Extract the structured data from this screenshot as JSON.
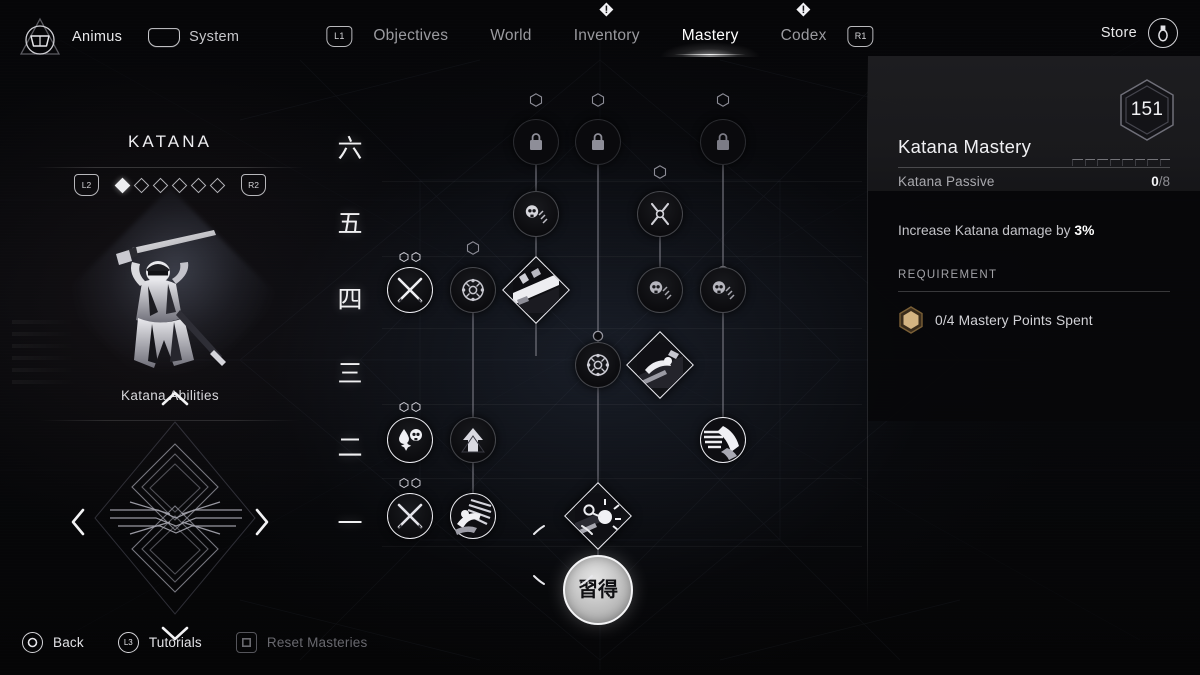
{
  "topbar": {
    "animus_label": "Animus",
    "animus_icon": "animus-triangle-icon",
    "system_label": "System",
    "system_icon": "trapezoid-touchpad-icon",
    "left_bumper": "L1",
    "right_bumper": "R1",
    "store_label": "Store",
    "store_icon": "store-circle-icon",
    "tabs": [
      {
        "label": "Objectives",
        "active": false,
        "badge": false
      },
      {
        "label": "World",
        "active": false,
        "badge": false
      },
      {
        "label": "Inventory",
        "active": false,
        "badge": true
      },
      {
        "label": "Mastery",
        "active": true,
        "badge": false
      },
      {
        "label": "Codex",
        "active": false,
        "badge": true
      }
    ]
  },
  "left_panel": {
    "title": "KATANA",
    "prev_trigger": "L2",
    "next_trigger": "R2",
    "page_dots": 6,
    "page_active_index": 0,
    "hero_caption": "Katana Abilities",
    "compass_icon": "ornamental-compass-icon",
    "chevrons": [
      "chevron-up-icon",
      "chevron-right-icon",
      "chevron-down-icon",
      "chevron-left-icon"
    ]
  },
  "tree": {
    "row_labels": [
      "六",
      "五",
      "四",
      "三",
      "二",
      "一"
    ],
    "root_node": {
      "kanji": "習得",
      "name": "mastery-root-node"
    },
    "nodes": [
      {
        "id": "n61",
        "row": 6,
        "col": 1,
        "shape": "circle",
        "state": "locked",
        "icon": "padlock-icon",
        "cost_pips": 0,
        "cost_hex": true
      },
      {
        "id": "n62",
        "row": 6,
        "col": 2,
        "shape": "circle",
        "state": "locked",
        "icon": "padlock-icon",
        "cost_pips": 0,
        "cost_hex": true
      },
      {
        "id": "n63",
        "row": 6,
        "col": 3,
        "shape": "circle",
        "state": "locked",
        "icon": "padlock-icon",
        "cost_pips": 0,
        "cost_hex": true
      },
      {
        "id": "n51",
        "row": 5,
        "col": 1,
        "shape": "circle",
        "state": "dim",
        "icon": "skull-strike-icon",
        "cost_pips": 0,
        "cost_hex": true
      },
      {
        "id": "n52",
        "row": 5,
        "col": 3,
        "shape": "circle",
        "state": "dim",
        "icon": "crossed-tools-icon",
        "cost_pips": 0,
        "cost_hex": true
      },
      {
        "id": "n41",
        "row": 4,
        "col": 0,
        "shape": "circle",
        "state": "bright",
        "icon": "crossed-blades-icon",
        "cost_pips": 2,
        "cost_hex": false
      },
      {
        "id": "n42",
        "row": 4,
        "col": 1,
        "shape": "circle",
        "state": "dim",
        "icon": "tsuba-guard-icon",
        "cost_pips": 0,
        "cost_hex": true
      },
      {
        "id": "n43",
        "row": 4,
        "col": 2,
        "shape": "diamond",
        "state": "bright",
        "icon": "slash-ability-icon",
        "cost_pips": 0,
        "cost_hex": false
      },
      {
        "id": "n44",
        "row": 4,
        "col": 3,
        "shape": "circle",
        "state": "dim",
        "icon": "skull-strike-icon",
        "cost_pips": 0,
        "cost_hex": true
      },
      {
        "id": "n45",
        "row": 4,
        "col": 4,
        "shape": "circle",
        "state": "dim",
        "icon": "skull-strike-icon",
        "cost_pips": 0,
        "cost_hex": true
      },
      {
        "id": "n31",
        "row": 3,
        "col": 2,
        "shape": "circle",
        "state": "dim",
        "icon": "tsuba-guard-icon",
        "cost_pips": 0,
        "cost_hex": true
      },
      {
        "id": "n32",
        "row": 3,
        "col": 3,
        "shape": "diamond",
        "state": "bright",
        "icon": "lunge-ability-icon",
        "cost_pips": 0,
        "cost_hex": false
      },
      {
        "id": "n21",
        "row": 2,
        "col": 0,
        "shape": "circle",
        "state": "bright",
        "icon": "bleed-skull-icon",
        "cost_pips": 2,
        "cost_hex": false
      },
      {
        "id": "n22",
        "row": 2,
        "col": 1,
        "shape": "circle",
        "state": "dim",
        "icon": "up-arrow-icon",
        "cost_pips": 0,
        "cost_hex": true
      },
      {
        "id": "n23",
        "row": 2,
        "col": 4,
        "shape": "circle",
        "state": "bright",
        "icon": "dash-strike-icon",
        "cost_pips": 0,
        "cost_hex": false
      },
      {
        "id": "n11",
        "row": 1,
        "col": 0,
        "shape": "circle",
        "state": "bright",
        "icon": "crossed-blades-icon",
        "cost_pips": 2,
        "cost_hex": false
      },
      {
        "id": "n12",
        "row": 1,
        "col": 1,
        "shape": "circle",
        "state": "bright",
        "icon": "dash-strike-icon",
        "cost_pips": 0,
        "cost_hex": false
      },
      {
        "id": "n13",
        "row": 1,
        "col": 2,
        "shape": "diamond",
        "state": "bright",
        "icon": "burst-ability-icon",
        "cost_pips": 0,
        "cost_hex": false
      }
    ]
  },
  "detail_panel": {
    "currency_value": "151",
    "currency_icon": "hex-currency-icon",
    "title": "Katana Mastery",
    "subtitle": "Katana Passive",
    "progress_current": "0",
    "progress_total": "8",
    "progress_separator": "/",
    "progress_segments": 8,
    "description_prefix": "Increase Katana damage by ",
    "description_value": "3%",
    "requirement_label": "REQUIREMENT",
    "requirement_text": "0/4 Mastery Points Spent",
    "requirement_icon": "gold-hex-icon"
  },
  "bottom_bar": {
    "actions": [
      {
        "glyph": "○",
        "icon": "circle-button-icon",
        "label": "Back",
        "disabled": false
      },
      {
        "glyph": "L3",
        "icon": "l3-stick-icon",
        "label": "Tutorials",
        "disabled": false
      },
      {
        "glyph": "□",
        "icon": "square-button-icon",
        "label": "Reset Masteries",
        "disabled": true
      }
    ]
  },
  "colors": {
    "background": "#050506",
    "panel_header": "#1e1e21",
    "accent_gold": "#d4b483",
    "text_primary": "#f0f0f3",
    "text_dim": "#9a9a9f"
  }
}
